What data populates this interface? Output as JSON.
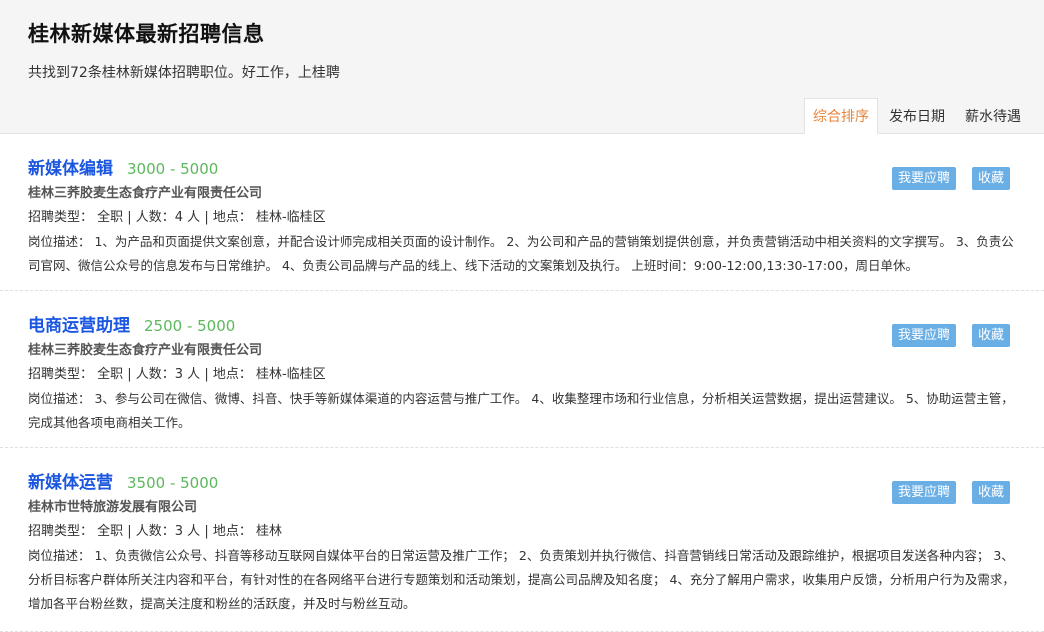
{
  "page": {
    "title": "桂林新媒体最新招聘信息",
    "subtitle": "共找到72条桂林新媒体招聘职位。好工作，上桂聘"
  },
  "sort_tabs": [
    {
      "label": "综合排序",
      "active": true
    },
    {
      "label": "发布日期",
      "active": false
    },
    {
      "label": "薪水待遇",
      "active": false
    }
  ],
  "buttons": {
    "apply_label": "我要应聘",
    "favorite_label": "收藏"
  },
  "colors": {
    "title_link": "#1a56e0",
    "salary": "#5cb85c",
    "active_tab": "#e8843a",
    "button_bg": "#6aaee6"
  },
  "jobs": [
    {
      "title": "新媒体编辑",
      "salary": "3000 - 5000",
      "company": "桂林三荞胶麦生态食疗产业有限责任公司",
      "meta": "招聘类型： 全职 | 人数：4 人 | 地点： 桂林-临桂区",
      "description": "岗位描述： 1、为产品和页面提供文案创意，并配合设计师完成相关页面的设计制作。 2、为公司和产品的营销策划提供创意，并负责营销活动中相关资料的文字撰写。 3、负责公司官网、微信公众号的信息发布与日常维护。 4、负责公司品牌与产品的线上、线下活动的文案策划及执行。 上班时间：9:00-12:00,13:30-17:00，周日单休。"
    },
    {
      "title": "电商运营助理",
      "salary": "2500 - 5000",
      "company": "桂林三荞胶麦生态食疗产业有限责任公司",
      "meta": "招聘类型： 全职 | 人数：3 人 | 地点： 桂林-临桂区",
      "description": "岗位描述： 3、参与公司在微信、微博、抖音、快手等新媒体渠道的内容运营与推广工作。 4、收集整理市场和行业信息，分析相关运营数据，提出运营建议。 5、协助运营主管，完成其他各项电商相关工作。"
    },
    {
      "title": "新媒体运营",
      "salary": "3500 - 5000",
      "company": "桂林市世特旅游发展有限公司",
      "meta": "招聘类型： 全职 | 人数：3 人 | 地点： 桂林",
      "description": "岗位描述： 1、负责微信公众号、抖音等移动互联网自媒体平台的日常运营及推广工作； 2、负责策划并执行微信、抖音营销线日常活动及跟踪维护，根据项目发送各种内容； 3、分析目标客户群体所关注内容和平台，有针对性的在各网络平台进行专题策划和活动策划，提高公司品牌及知名度； 4、充分了解用户需求，收集用户反馈，分析用户行为及需求，增加各平台粉丝数，提高关注度和粉丝的活跃度，并及时与粉丝互动。"
    }
  ]
}
